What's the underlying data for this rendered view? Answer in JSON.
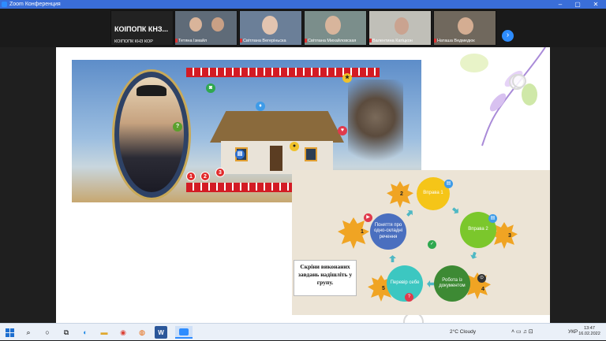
{
  "window": {
    "title": "Zoom Конференция",
    "controls": [
      "–",
      "▢",
      "✕"
    ]
  },
  "host_tile": {
    "big_label": "КОІПОПК КНЗ...",
    "name": "КОІПОПК КНЗ КОР"
  },
  "participants": [
    {
      "name": "Тетяна Ізмайл",
      "bg": "#5f6b78"
    },
    {
      "name": "Світлана Вегеріньска",
      "bg": "#6b7f98"
    },
    {
      "name": "Світлана Михайловская",
      "bg": "#7b8e8b"
    },
    {
      "name": "Валентина Катіцкон",
      "bg": "#c0bfb8"
    },
    {
      "name": "Наташа Ведмедюк",
      "bg": "#70685d"
    }
  ],
  "next_icon": "chevron-right-icon",
  "slide": {
    "badges": [
      "1",
      "2",
      "3"
    ],
    "card": {
      "nodes": {
        "concept": "Поняття про одно-складні речення",
        "ex1": "Вправа 1",
        "ex2": "Вправа 2",
        "docs": "Робота із документом",
        "check": "Перевір себе"
      },
      "leaf_numbers": [
        "1",
        "2",
        "3",
        "4",
        "5"
      ],
      "note": "Скріни виконаних завдань надішліть у групу."
    }
  },
  "taskbar": {
    "weather": "2°C  Cloudy",
    "lang": "УКР",
    "time": "13:47",
    "date": "16.02.2022"
  },
  "colors": {
    "accent": "#2d8cff",
    "titlebar": "#3a6ed8",
    "ornament": "#d31b24",
    "leaf": "#f0a423"
  }
}
